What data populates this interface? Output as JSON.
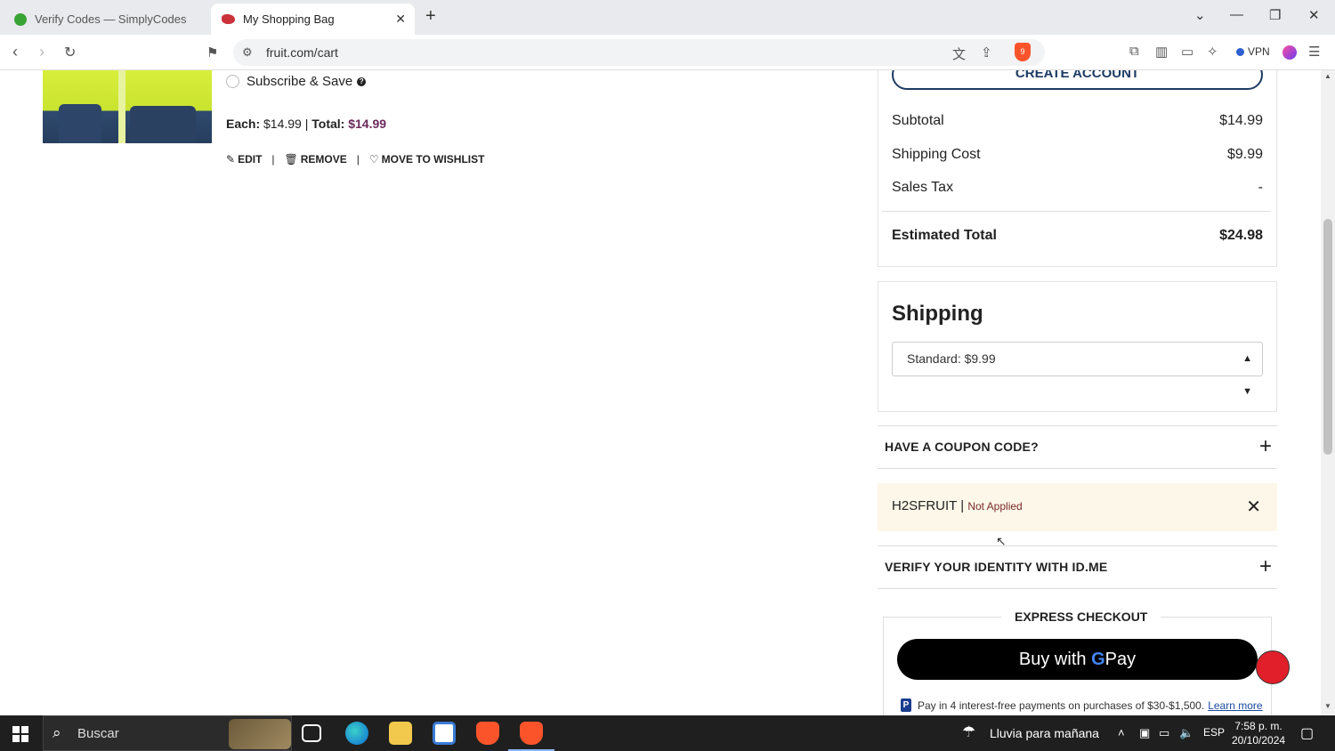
{
  "browser": {
    "tabs": [
      {
        "title": "Verify Codes — SimplyCodes",
        "active": false
      },
      {
        "title": "My Shopping Bag",
        "active": true
      }
    ],
    "url": "fruit.com/cart",
    "vpn_label": "VPN",
    "brave_badge": "9"
  },
  "cart_item": {
    "subscribe_label": "Subscribe & Save",
    "each_label": "Each:",
    "each_price": "$14.99",
    "total_label": "Total:",
    "total_price": "$14.99",
    "edit_label": "EDIT",
    "remove_label": "REMOVE",
    "wishlist_label": "MOVE TO WISHLIST"
  },
  "summary": {
    "create_account_label": "CREATE ACCOUNT",
    "subtotal_label": "Subtotal",
    "subtotal_value": "$14.99",
    "shipping_label": "Shipping Cost",
    "shipping_value": "$9.99",
    "tax_label": "Sales Tax",
    "tax_value": "-",
    "total_label": "Estimated Total",
    "total_value": "$24.98"
  },
  "shipping": {
    "title": "Shipping",
    "selected_option": "Standard: $9.99"
  },
  "coupon": {
    "section_label": "HAVE A COUPON CODE?",
    "code": "H2SFRUIT",
    "separator": "|",
    "status": "Not Applied"
  },
  "idme": {
    "label": "VERIFY YOUR IDENTITY WITH ID.ME"
  },
  "express": {
    "title": "EXPRESS CHECKOUT",
    "gpay_prefix": "Buy with",
    "gpay_g": "G",
    "gpay_suffix": "Pay",
    "paypal_text": "Pay in 4 interest-free payments on purchases of $30-$1,500.",
    "learn_more": "Learn more"
  },
  "taskbar": {
    "search_placeholder": "Buscar",
    "weather": "Lluvia para mañana",
    "language": "ESP",
    "time": "7:58 p. m.",
    "date": "20/10/2024"
  },
  "colors": {
    "accent_navy": "#1c3a63",
    "price_purple": "#6a2a5a",
    "coupon_bg": "#fcf7e8",
    "brave_orange": "#fb542b"
  }
}
